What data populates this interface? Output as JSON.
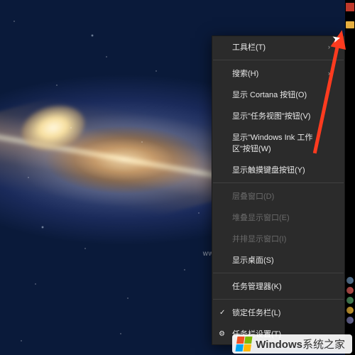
{
  "menu": {
    "items": [
      {
        "label": "工具栏(T)",
        "hasSubmenu": true,
        "enabled": true
      },
      {
        "sep": true
      },
      {
        "label": "搜索(H)",
        "hasSubmenu": true,
        "enabled": true
      },
      {
        "label": "显示 Cortana 按钮(O)",
        "enabled": true
      },
      {
        "label": "显示\"任务视图\"按钮(V)",
        "enabled": true
      },
      {
        "label": "显示\"Windows Ink 工作区\"按钮(W)",
        "enabled": true
      },
      {
        "label": "显示触摸键盘按钮(Y)",
        "enabled": true
      },
      {
        "sep": true
      },
      {
        "label": "层叠窗口(D)",
        "enabled": false
      },
      {
        "label": "堆叠显示窗口(E)",
        "enabled": false
      },
      {
        "label": "并排显示窗口(I)",
        "enabled": false
      },
      {
        "label": "显示桌面(S)",
        "enabled": true
      },
      {
        "sep": true
      },
      {
        "label": "任务管理器(K)",
        "enabled": true
      },
      {
        "sep": true
      },
      {
        "label": "锁定任务栏(L)",
        "enabled": true,
        "checked": true
      },
      {
        "label": "任务栏设置(T)",
        "enabled": true,
        "hasIcon": true
      }
    ]
  },
  "watermark": {
    "brand": "Windows",
    "suffix": "系统之家",
    "url": "www.bjjmmc.com"
  },
  "annotation": {
    "color": "#ff3b1f"
  }
}
